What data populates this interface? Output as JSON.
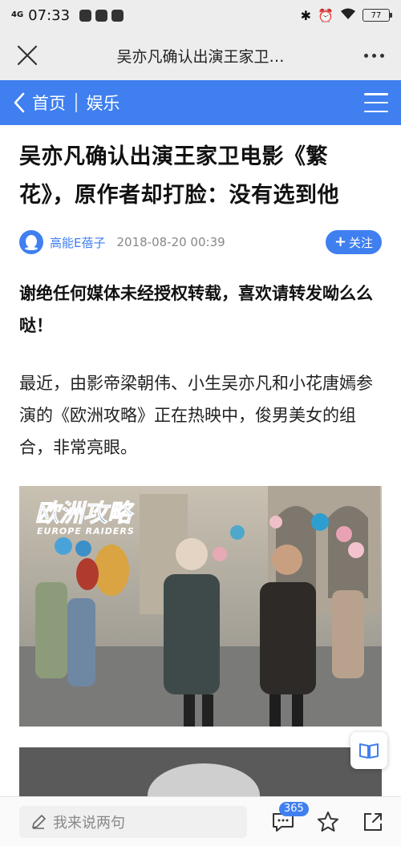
{
  "status_bar": {
    "network": "4G",
    "time": "07:33",
    "battery": "77"
  },
  "title_bar": {
    "title": "吴亦凡确认出演王家卫…"
  },
  "nav": {
    "back_label": "首页",
    "section_label": "娱乐"
  },
  "article": {
    "headline": "吴亦凡确认出演王家卫电影《繁花》，原作者却打脸：没有选到他",
    "author": "高能E蓓子",
    "published": "2018-08-20 00:39",
    "follow_label": "关注",
    "notice": "谢绝任何媒体未经授权转载，喜欢请转发呦么么哒！",
    "paragraph": "最近，由影帝梁朝伟、小生吴亦凡和小花唐嫣参演的《欧洲攻略》正在热映中，俊男美女的组合，非常亮眼。",
    "image_caption_cn": "欧洲攻略",
    "image_caption_en": "EUROPE RAIDERS"
  },
  "bottom_bar": {
    "comment_placeholder": "我来说两句",
    "comment_count": "365"
  },
  "colors": {
    "accent": "#3f7ff0",
    "chrome": "#ededed"
  }
}
